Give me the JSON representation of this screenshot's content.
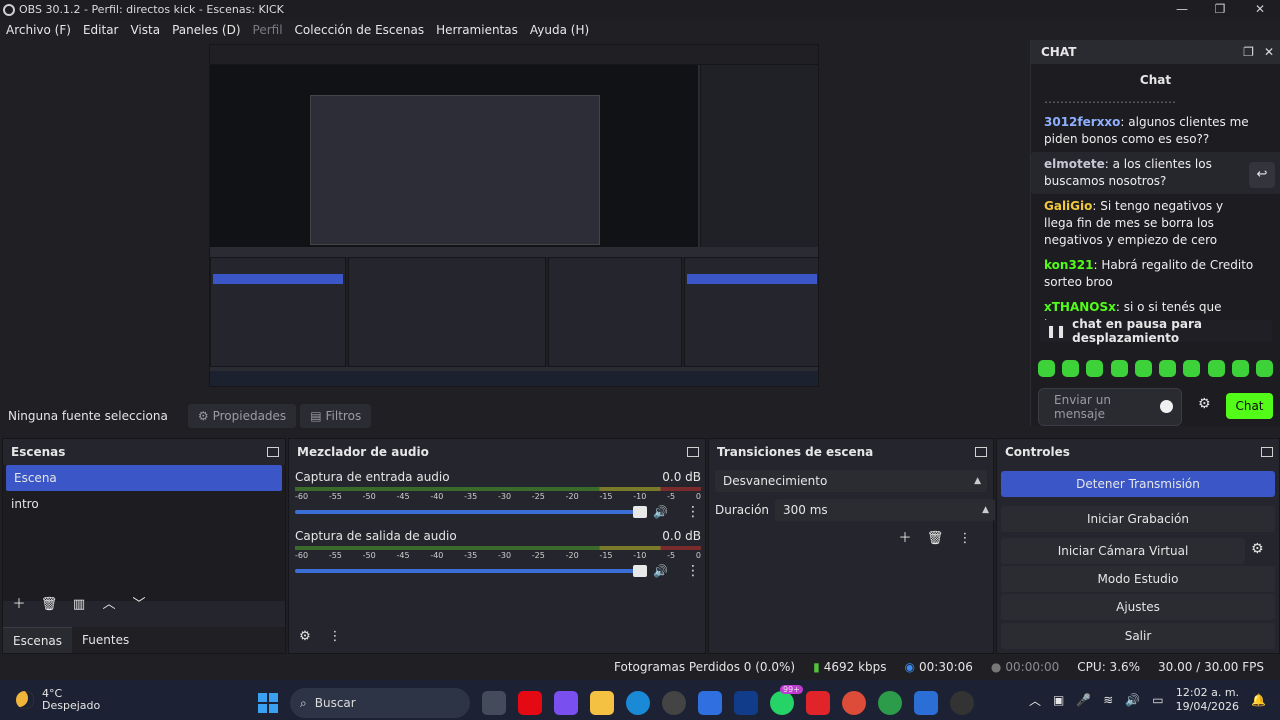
{
  "window": {
    "title": "OBS 30.1.2 - Perfil: directos kick - Escenas: KICK",
    "minimize": "—",
    "maximize": "❐",
    "close": "✕"
  },
  "menu": [
    "Archivo (F)",
    "Editar",
    "Vista",
    "Paneles (D)",
    "Perfil",
    "Colección de Escenas",
    "Herramientas",
    "Ayuda (H)"
  ],
  "chat": {
    "dock_title": "CHAT",
    "header": "Chat",
    "messages": [
      {
        "user": "3012ferxxo",
        "color": "#8fb0ff",
        "text": "algunos clientes me piden bonos como es eso??"
      },
      {
        "user": "elmotete",
        "color": "#c6c6d6",
        "text": "a los clientes los buscamos nosotros?"
      },
      {
        "user": "GaliGio",
        "color": "#f0c83a",
        "text": "Si tengo negativos y llega fin de mes se borra los negativos y empiezo de cero"
      },
      {
        "user": "kon321",
        "color": "#53fc18",
        "text": "Habrá regalito de Credito sorteo broo"
      },
      {
        "user": "xTHANOSx",
        "color": "#53fc18",
        "text": "si o si tenés que tener"
      }
    ],
    "paused_label": "chat en pausa para desplazamiento",
    "input_placeholder": "Enviar un mensaje",
    "send_label": "Chat"
  },
  "source_toolbar": {
    "label": "Ninguna fuente selecciona",
    "properties": "Propiedades",
    "filters": "Filtros"
  },
  "scenes": {
    "title": "Escenas",
    "items": [
      "Escena",
      "intro"
    ],
    "tabs": [
      "Escenas",
      "Fuentes"
    ]
  },
  "mixer": {
    "title": "Mezclador de audio",
    "channels": [
      {
        "name": "Captura de entrada audio",
        "level": "0.0 dB",
        "volume": 1.0
      },
      {
        "name": "Captura de salida de audio",
        "level": "0.0 dB",
        "volume": 1.0
      }
    ],
    "ticks": [
      "-60",
      "-55",
      "-50",
      "-45",
      "-40",
      "-35",
      "-30",
      "-25",
      "-20",
      "-15",
      "-10",
      "-5",
      "0"
    ]
  },
  "transitions": {
    "title": "Transiciones de escena",
    "selected": "Desvanecimiento",
    "duration_label": "Duración",
    "duration_value": "300 ms"
  },
  "controls": {
    "title": "Controles",
    "buttons": [
      "Detener Transmisión",
      "Iniciar Grabación",
      "Iniciar Cámara Virtual",
      "Modo Estudio",
      "Ajustes",
      "Salir"
    ]
  },
  "status": {
    "frames": "Fotogramas Perdidos 0 (0.0%)",
    "bitrate": "4692 kbps",
    "stream_time": "00:30:06",
    "rec_time": "00:00:00",
    "cpu": "CPU: 3.6%",
    "fps": "30.00 / 30.00 FPS"
  },
  "taskbar": {
    "temp": "4°C",
    "weather": "Despejado",
    "search": "Buscar",
    "badge": "99+",
    "time": "12:02 a. m.",
    "date": "19/04/2026"
  },
  "colors": {
    "accent": "#3b57c7",
    "kick_green": "#53fc18"
  }
}
